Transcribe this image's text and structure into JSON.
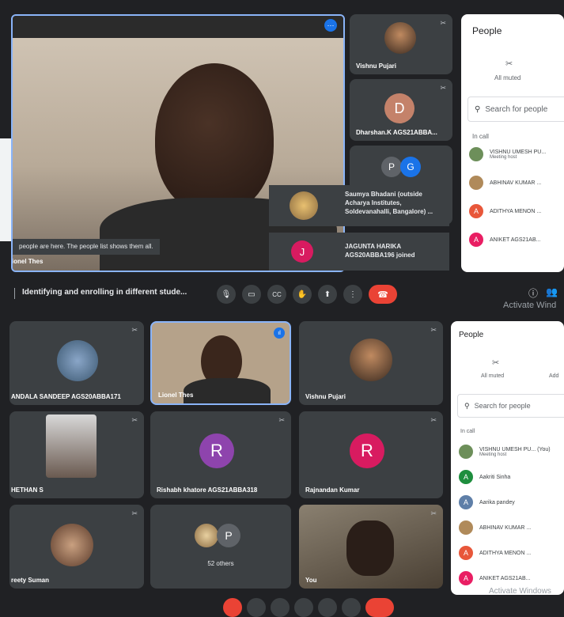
{
  "top": {
    "main_speaker": "Lionel Thes",
    "main_banner": "people are here. The people list shows them all.",
    "side_tiles": [
      "Vishnu Pujari",
      "Dharshan.K AGS21ABBA..."
    ],
    "group_avatars": [
      "P",
      "G"
    ],
    "toast_1": "Saumya Bhadani (outside Acharya Institutes, Soldevanahalli, Bangalore) ...",
    "toast_2_initial": "J",
    "toast_2": "JAGUNTA HARIKA AGS20ABBA196 joined",
    "meeting_title": "Identifying and enrolling in different stude...",
    "people_panel": {
      "title": "People",
      "all_muted": "All muted",
      "search_placeholder": "Search for people",
      "in_call": "In call",
      "rows": [
        {
          "initial": "",
          "name": "VISHNU UMESH PU...",
          "sub": "Meeting host",
          "color": "#6d8f5a"
        },
        {
          "initial": "",
          "name": "ABHINAV KUMAR ...",
          "sub": "",
          "color": "#b08a5a"
        },
        {
          "initial": "A",
          "name": "ADITHYA MENON ...",
          "sub": "",
          "color": "#e8573a"
        },
        {
          "initial": "A",
          "name": "ANIKET AGS21AB...",
          "sub": "",
          "color": "#e91e63"
        }
      ]
    },
    "watermark": "Activate Wind"
  },
  "bottom": {
    "tiles": [
      {
        "name": "ANDALA SANDEEP AGS20ABBA171"
      },
      {
        "name": "Lionel Thes"
      },
      {
        "name": "Vishnu Pujari"
      },
      {
        "name": "HETHAN S"
      },
      {
        "name": "Rishabh khatore AGS21ABBA318",
        "initial": "R"
      },
      {
        "name": "Rajnandan Kumar",
        "initial": "R"
      },
      {
        "name": "reety Suman"
      },
      {
        "name": "52 others",
        "initial": "P"
      },
      {
        "name": "You"
      }
    ],
    "people_panel": {
      "title": "People",
      "all_muted": "All muted",
      "add": "Add",
      "search_placeholder": "Search for people",
      "in_call": "In call",
      "rows": [
        {
          "initial": "",
          "name": "VISHNU UMESH PU...",
          "suffix": "(You)",
          "sub": "Meeting host",
          "color": "#6d8f5a"
        },
        {
          "initial": "A",
          "name": "Aakriti Sinha",
          "suffix": "",
          "sub": "",
          "color": "#1e8e3e"
        },
        {
          "initial": "A",
          "name": "Aarika pandey",
          "suffix": "",
          "sub": "",
          "color": "#5f7fa8"
        },
        {
          "initial": "",
          "name": "ABHINAV KUMAR ...",
          "suffix": "",
          "sub": "",
          "color": "#b08a5a"
        },
        {
          "initial": "A",
          "name": "ADITHYA MENON ...",
          "suffix": "",
          "sub": "",
          "color": "#e8573a"
        },
        {
          "initial": "A",
          "name": "ANIKET AGS21AB...",
          "suffix": "",
          "sub": "",
          "color": "#e91e63"
        }
      ]
    },
    "watermark": "Activate Windows"
  }
}
